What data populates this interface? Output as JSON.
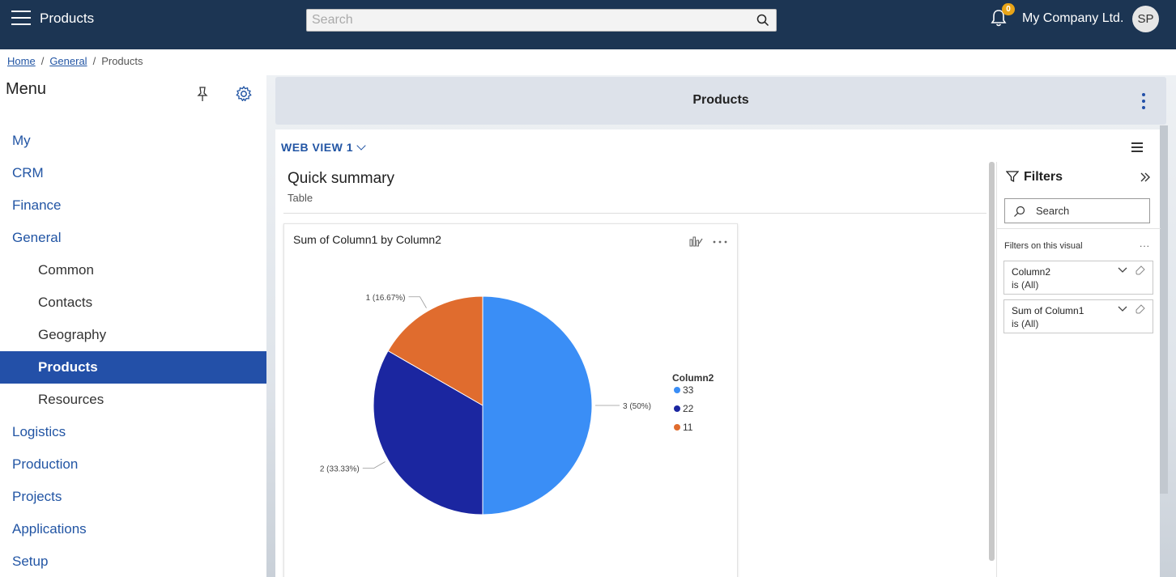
{
  "topbar": {
    "app_title": "Products",
    "search_placeholder": "Search",
    "notification_count": "0",
    "company": "My Company Ltd.",
    "avatar_initials": "SP"
  },
  "breadcrumb": {
    "items": [
      "Home",
      "General",
      "Products"
    ]
  },
  "sidebar": {
    "title": "Menu",
    "items": [
      {
        "label": "My"
      },
      {
        "label": "CRM"
      },
      {
        "label": "Finance"
      },
      {
        "label": "General"
      },
      {
        "label": "Common"
      },
      {
        "label": "Contacts"
      },
      {
        "label": "Geography"
      },
      {
        "label": "Products"
      },
      {
        "label": "Resources"
      },
      {
        "label": "Logistics"
      },
      {
        "label": "Production"
      },
      {
        "label": "Projects"
      },
      {
        "label": "Applications"
      },
      {
        "label": "Setup"
      }
    ]
  },
  "main": {
    "title": "Products",
    "view_selector": "WEB VIEW 1"
  },
  "report": {
    "title": "Quick summary",
    "subtitle": "Table",
    "visual_title": "Sum of Column1 by Column2"
  },
  "chart_data": {
    "type": "pie",
    "title": "Sum of Column1 by Column2",
    "legend_title": "Column2",
    "legend_position": "right",
    "slices": [
      {
        "category": "33",
        "value": 3,
        "label": "3 (50%)",
        "color": "#3a8ef6"
      },
      {
        "category": "22",
        "value": 2,
        "label": "2 (33.33%)",
        "color": "#1b26a0"
      },
      {
        "category": "11",
        "value": 1,
        "label": "1 (16.67%)",
        "color": "#e06c2e"
      }
    ]
  },
  "filters": {
    "title": "Filters",
    "search_placeholder": "Search",
    "section_label": "Filters on this visual",
    "more": "...",
    "cards": [
      {
        "name": "Column2",
        "value": "is (All)"
      },
      {
        "name": "Sum of Column1",
        "value": "is (All)"
      }
    ]
  }
}
